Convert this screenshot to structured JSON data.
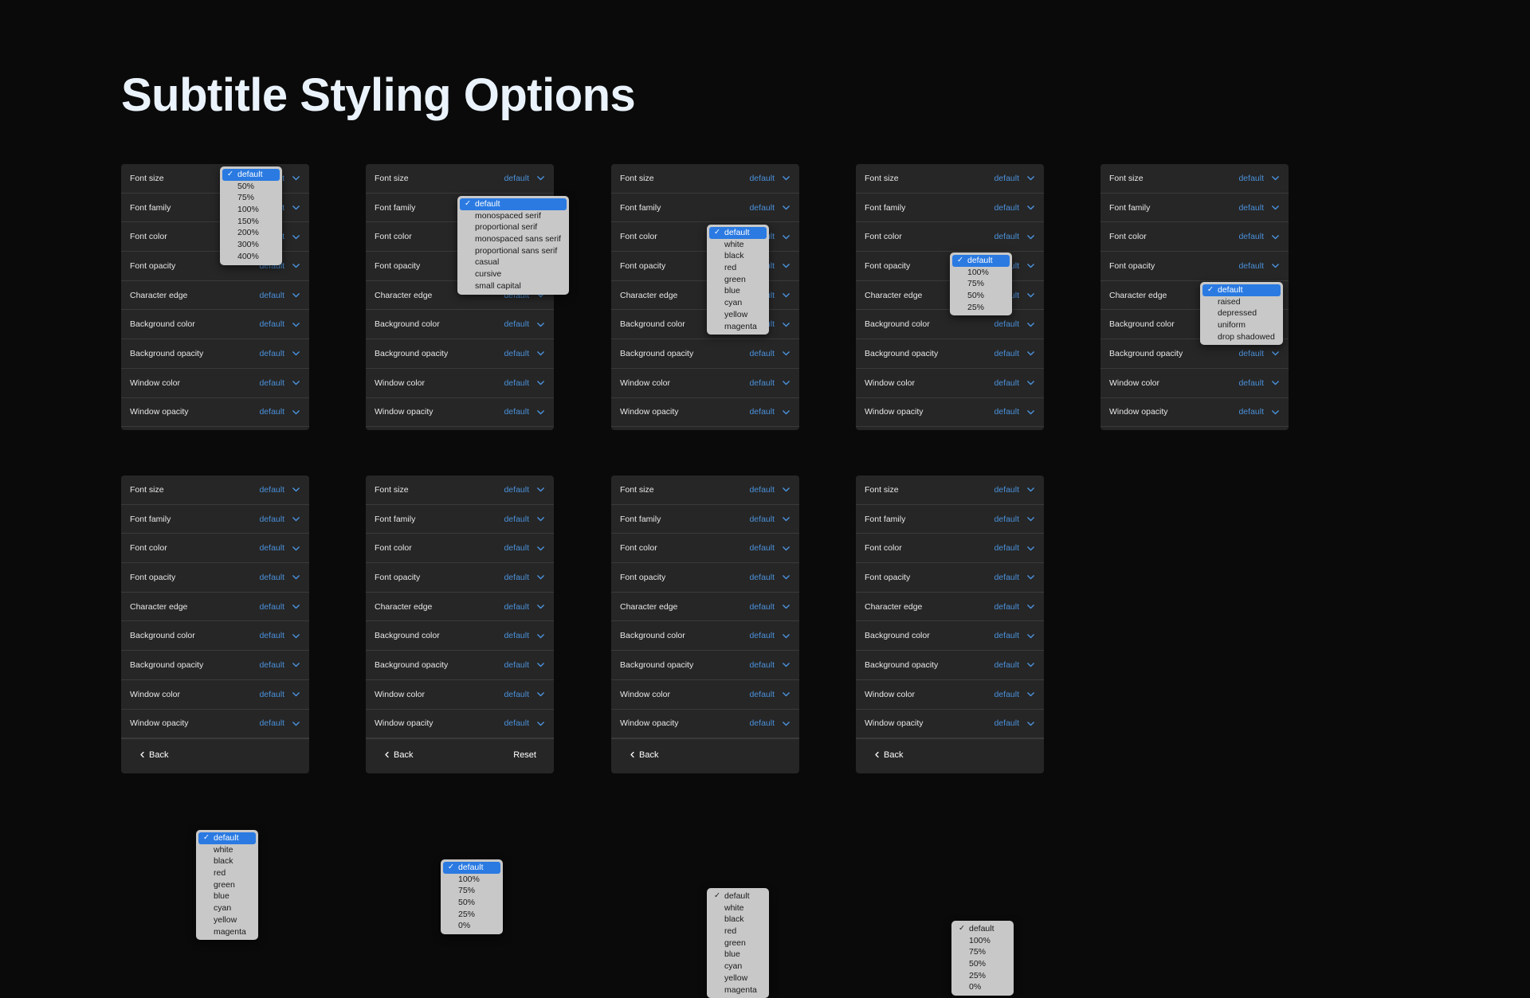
{
  "page": {
    "title": "Subtitle Styling Options",
    "background_color": "#0a0a0a",
    "panel_color": "#262626",
    "accent_color": "#4a90d9",
    "dropdown_bg": "#c8c8c8",
    "dropdown_highlight": "#2a7ae2"
  },
  "rows": {
    "font_size": "Font size",
    "font_family": "Font family",
    "font_color": "Font color",
    "font_opacity": "Font opacity",
    "character_edge": "Character edge",
    "background_color": "Background color",
    "background_opacity": "Background opacity",
    "window_color": "Window color",
    "window_opacity": "Window opacity"
  },
  "default_value": "default",
  "buttons": {
    "back": "Back",
    "reset": "Reset"
  },
  "options": {
    "size": [
      "default",
      "50%",
      "75%",
      "100%",
      "150%",
      "200%",
      "300%",
      "400%"
    ],
    "family": [
      "default",
      "monospaced serif",
      "proportional serif",
      "monospaced sans serif",
      "proportional sans serif",
      "casual",
      "cursive",
      "small capital"
    ],
    "color": [
      "default",
      "white",
      "black",
      "red",
      "green",
      "blue",
      "cyan",
      "yellow",
      "magenta"
    ],
    "opacity": [
      "default",
      "100%",
      "75%",
      "50%",
      "25%"
    ],
    "edge": [
      "default",
      "raised",
      "depressed",
      "uniform",
      "drop shadowed"
    ],
    "bg_opacity": [
      "default",
      "100%",
      "75%",
      "50%",
      "25%",
      "0%"
    ],
    "win_opacity": [
      "default",
      "100%",
      "75%",
      "50%",
      "25%",
      "0%"
    ]
  },
  "panels": [
    {
      "id": "panel-font-size",
      "open_row": "font_size",
      "option_set": "size"
    },
    {
      "id": "panel-font-family",
      "open_row": "font_family",
      "option_set": "family"
    },
    {
      "id": "panel-font-color",
      "open_row": "font_color",
      "option_set": "color"
    },
    {
      "id": "panel-font-opacity",
      "open_row": "font_opacity",
      "option_set": "opacity"
    },
    {
      "id": "panel-character-edge",
      "open_row": "character_edge",
      "option_set": "edge"
    },
    {
      "id": "panel-background-color",
      "open_row": "background_color",
      "option_set": "color"
    },
    {
      "id": "panel-background-opacity",
      "open_row": "background_opacity",
      "option_set": "bg_opacity"
    },
    {
      "id": "panel-window-color",
      "open_row": "window_color",
      "option_set": "color"
    },
    {
      "id": "panel-window-opacity",
      "open_row": "window_opacity",
      "option_set": "win_opacity"
    }
  ]
}
